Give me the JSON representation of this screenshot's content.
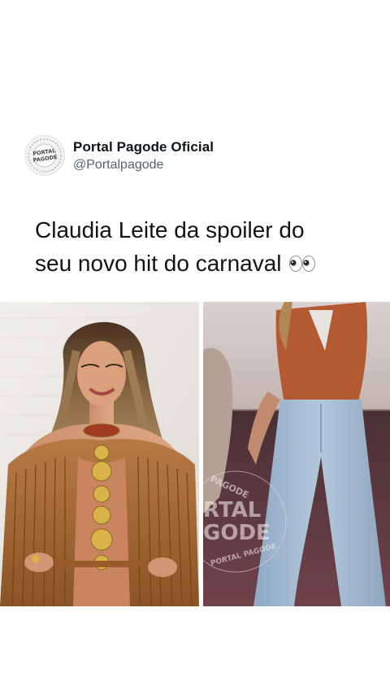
{
  "tweet": {
    "display_name": "Portal Pagode Oficial",
    "handle": "@Portalpagode",
    "avatar_logo_lines": [
      "PORTAL",
      "PAGODE"
    ],
    "text_line_1": "Claudia Leite da spoiler do",
    "text_line_2": "seu novo hit do carnaval",
    "emoji": "eyes-emoji"
  },
  "media": {
    "left_photo": "woman-fringe-outfit-photo",
    "right_photo": "dancing-jeans-photo",
    "watermark_lines": [
      "PAGODE",
      "RTAL",
      "GODE",
      "PORTAL PAGODE"
    ]
  },
  "colors": {
    "text": "#0f1419",
    "handle": "#536471",
    "background": "#ffffff"
  }
}
